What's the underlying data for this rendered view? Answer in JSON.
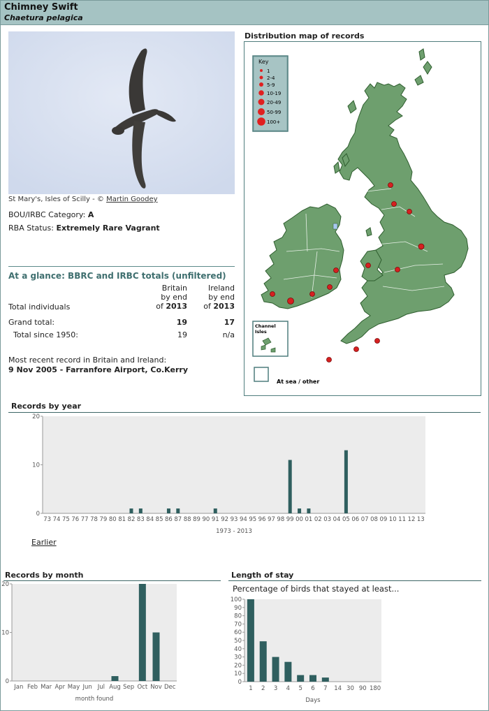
{
  "header": {
    "common_name": "Chimney Swift",
    "scientific_name": "Chaetura pelagica"
  },
  "photo": {
    "caption_prefix": "St Mary's, Isles of Scilly - © ",
    "photographer": "Martin Goodey"
  },
  "category": {
    "label": "BOU/IRBC Category: ",
    "value": "A"
  },
  "rba": {
    "label": "RBA Status: ",
    "value": "Extremely Rare Vagrant"
  },
  "glance": {
    "title": "At a glance: BBRC and IRBC totals (unfiltered)",
    "britain_head": [
      "Britain",
      "by end",
      "of "
    ],
    "ireland_head": [
      "Ireland",
      "by end",
      "of "
    ],
    "year": "2013",
    "total_individuals_label": "Total individuals",
    "grand_total_label": "Grand total:",
    "grand_total_britain": "19",
    "grand_total_ireland": "17",
    "since1950_label": "Total since 1950:",
    "since1950_britain": "19",
    "since1950_ireland": "n/a",
    "recent_label": "Most recent record in Britain and Ireland:",
    "recent_value": "9 Nov 2005  - Farranfore Airport, Co.Kerry"
  },
  "map": {
    "title": "Distribution map of records",
    "key_title": "Key",
    "key_items": [
      "1",
      "2-4",
      "5-9",
      "10-19",
      "20-49",
      "50-99",
      "100+"
    ],
    "channel_label": "Channel Isles",
    "sea_label": "At sea / other",
    "land_color": "#6e9f6e",
    "dot_color": "#d62020"
  },
  "records_by_year": {
    "title": "Records by year",
    "earlier_link": "Earlier",
    "chart_data": {
      "type": "bar",
      "categories": [
        "73",
        "74",
        "75",
        "76",
        "77",
        "78",
        "79",
        "80",
        "81",
        "82",
        "83",
        "84",
        "85",
        "86",
        "87",
        "88",
        "89",
        "90",
        "91",
        "92",
        "93",
        "94",
        "95",
        "96",
        "97",
        "98",
        "99",
        "00",
        "01",
        "02",
        "03",
        "04",
        "05",
        "06",
        "07",
        "08",
        "09",
        "10",
        "11",
        "12",
        "13"
      ],
      "values": [
        0,
        0,
        0,
        0,
        0,
        0,
        0,
        0,
        0,
        1,
        1,
        0,
        0,
        1,
        1,
        0,
        0,
        0,
        1,
        0,
        0,
        0,
        0,
        0,
        0,
        0,
        11,
        1,
        1,
        0,
        0,
        0,
        13,
        0,
        0,
        0,
        0,
        0,
        0,
        0,
        0
      ],
      "xlabel": "1973 - 2013",
      "yticks": [
        "0",
        "10",
        "20"
      ],
      "ylim": [
        0,
        20
      ],
      "bar_color": "#2f5f5f"
    }
  },
  "records_by_month": {
    "title": "Records by month",
    "chart_data": {
      "type": "bar",
      "categories": [
        "Jan",
        "Feb",
        "Mar",
        "Apr",
        "May",
        "Jun",
        "Jul",
        "Aug",
        "Sep",
        "Oct",
        "Nov",
        "Dec"
      ],
      "values": [
        0,
        0,
        0,
        0,
        0,
        0,
        0,
        1,
        0,
        20,
        10,
        0
      ],
      "xlabel": "month found",
      "yticks": [
        "0",
        "10",
        "20"
      ],
      "ylim": [
        0,
        20
      ],
      "bar_color": "#2f5f5f"
    }
  },
  "length_of_stay": {
    "title": "Length of stay",
    "subtitle": "Percentage of birds that stayed at least...",
    "chart_data": {
      "type": "bar",
      "categories": [
        "1",
        "2",
        "3",
        "4",
        "5",
        "6",
        "7",
        "14",
        "30",
        "90",
        "180"
      ],
      "values": [
        100,
        49,
        30,
        24,
        8,
        8,
        5,
        0,
        0,
        0,
        0
      ],
      "xlabel": "Days",
      "yticks": [
        "0",
        "10",
        "20",
        "30",
        "40",
        "50",
        "60",
        "70",
        "80",
        "90",
        "100"
      ],
      "ylim": [
        0,
        100
      ],
      "bar_color": "#2f5f5f"
    }
  }
}
